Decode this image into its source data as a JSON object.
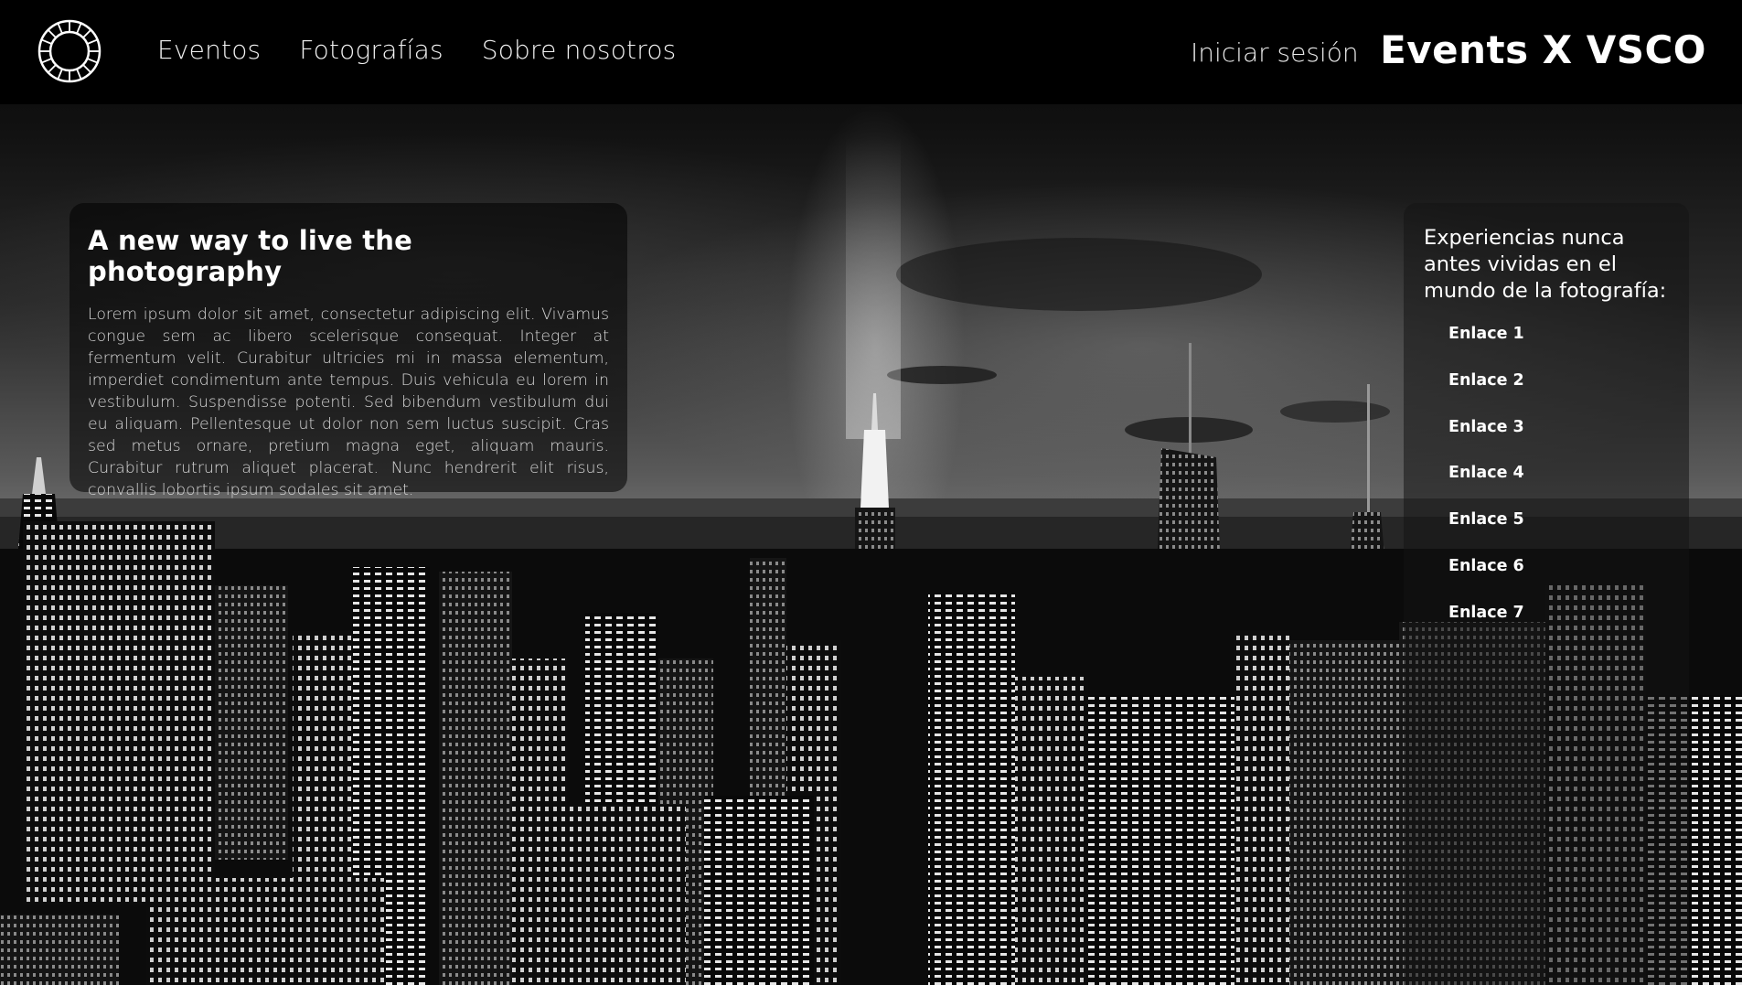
{
  "header": {
    "logo_icon": "vsco-ring-logo-icon",
    "nav": [
      {
        "label": "Eventos"
      },
      {
        "label": "Fotografías"
      },
      {
        "label": "Sobre nosotros"
      }
    ],
    "login_label": "Iniciar sesión",
    "brand": "Events X VSCO"
  },
  "intro": {
    "title": "A new way to live the photography",
    "body": "Lorem ipsum dolor sit amet, consectetur adipiscing elit. Vivamus congue sem ac libero scelerisque consequat. Integer at fermentum velit. Curabitur ultricies mi in massa elementum, imperdiet condimentum ante tempus. Duis vehicula eu lorem in vestibulum. Suspendisse potenti. Sed bibendum vestibulum dui eu aliquam. Pellentesque ut dolor non sem luctus suscipit. Cras sed metus ornare, pretium magna eget, aliquam mauris. Curabitur rutrum aliquet placerat. Nunc hendrerit elit risus, convallis lobortis ipsum sodales sit amet."
  },
  "links_panel": {
    "heading": "Experiencias nunca antes vividas en el mundo de la fotografía:",
    "links": [
      {
        "label": "Enlace 1"
      },
      {
        "label": "Enlace 2"
      },
      {
        "label": "Enlace 3"
      },
      {
        "label": "Enlace 4"
      },
      {
        "label": "Enlace 5"
      },
      {
        "label": "Enlace 6"
      },
      {
        "label": "Enlace 7"
      }
    ]
  },
  "background": {
    "style": "black-and-white night city skyline"
  }
}
